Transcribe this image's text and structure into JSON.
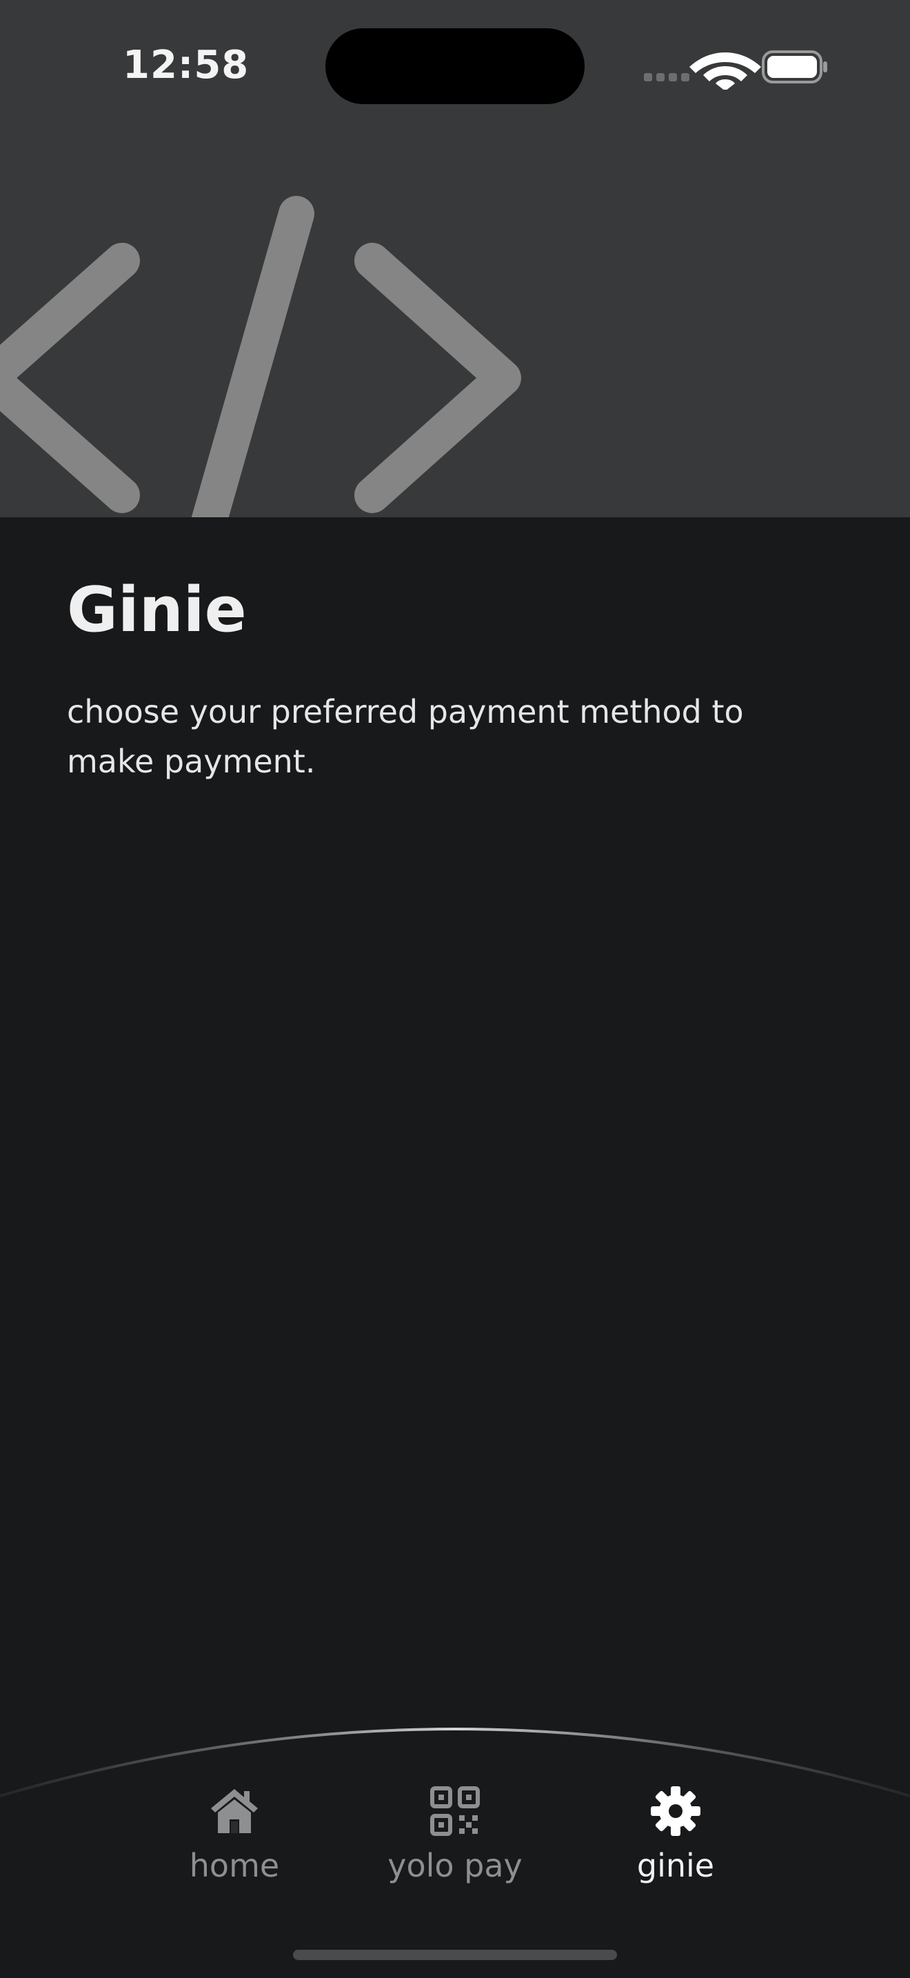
{
  "status_bar": {
    "time": "12:58",
    "icons": [
      "cellular-signal-icon",
      "wifi-icon",
      "battery-icon"
    ]
  },
  "hero": {
    "icon": "code-brackets-icon",
    "background_color": "#38393a",
    "icon_color": "#858585"
  },
  "main": {
    "title": "Ginie",
    "description": "choose your preferred payment method to make payment."
  },
  "tab_bar": {
    "tabs": [
      {
        "label": "home",
        "icon": "home-icon",
        "active": false
      },
      {
        "label": "yolo pay",
        "icon": "qr-code-icon",
        "active": false
      },
      {
        "label": "ginie",
        "icon": "gear-icon",
        "active": true
      }
    ]
  },
  "colors": {
    "background": "#18191b",
    "text_primary": "#efefef",
    "tab_inactive": "#8e8f91",
    "tab_active": "#f2f2f2"
  }
}
